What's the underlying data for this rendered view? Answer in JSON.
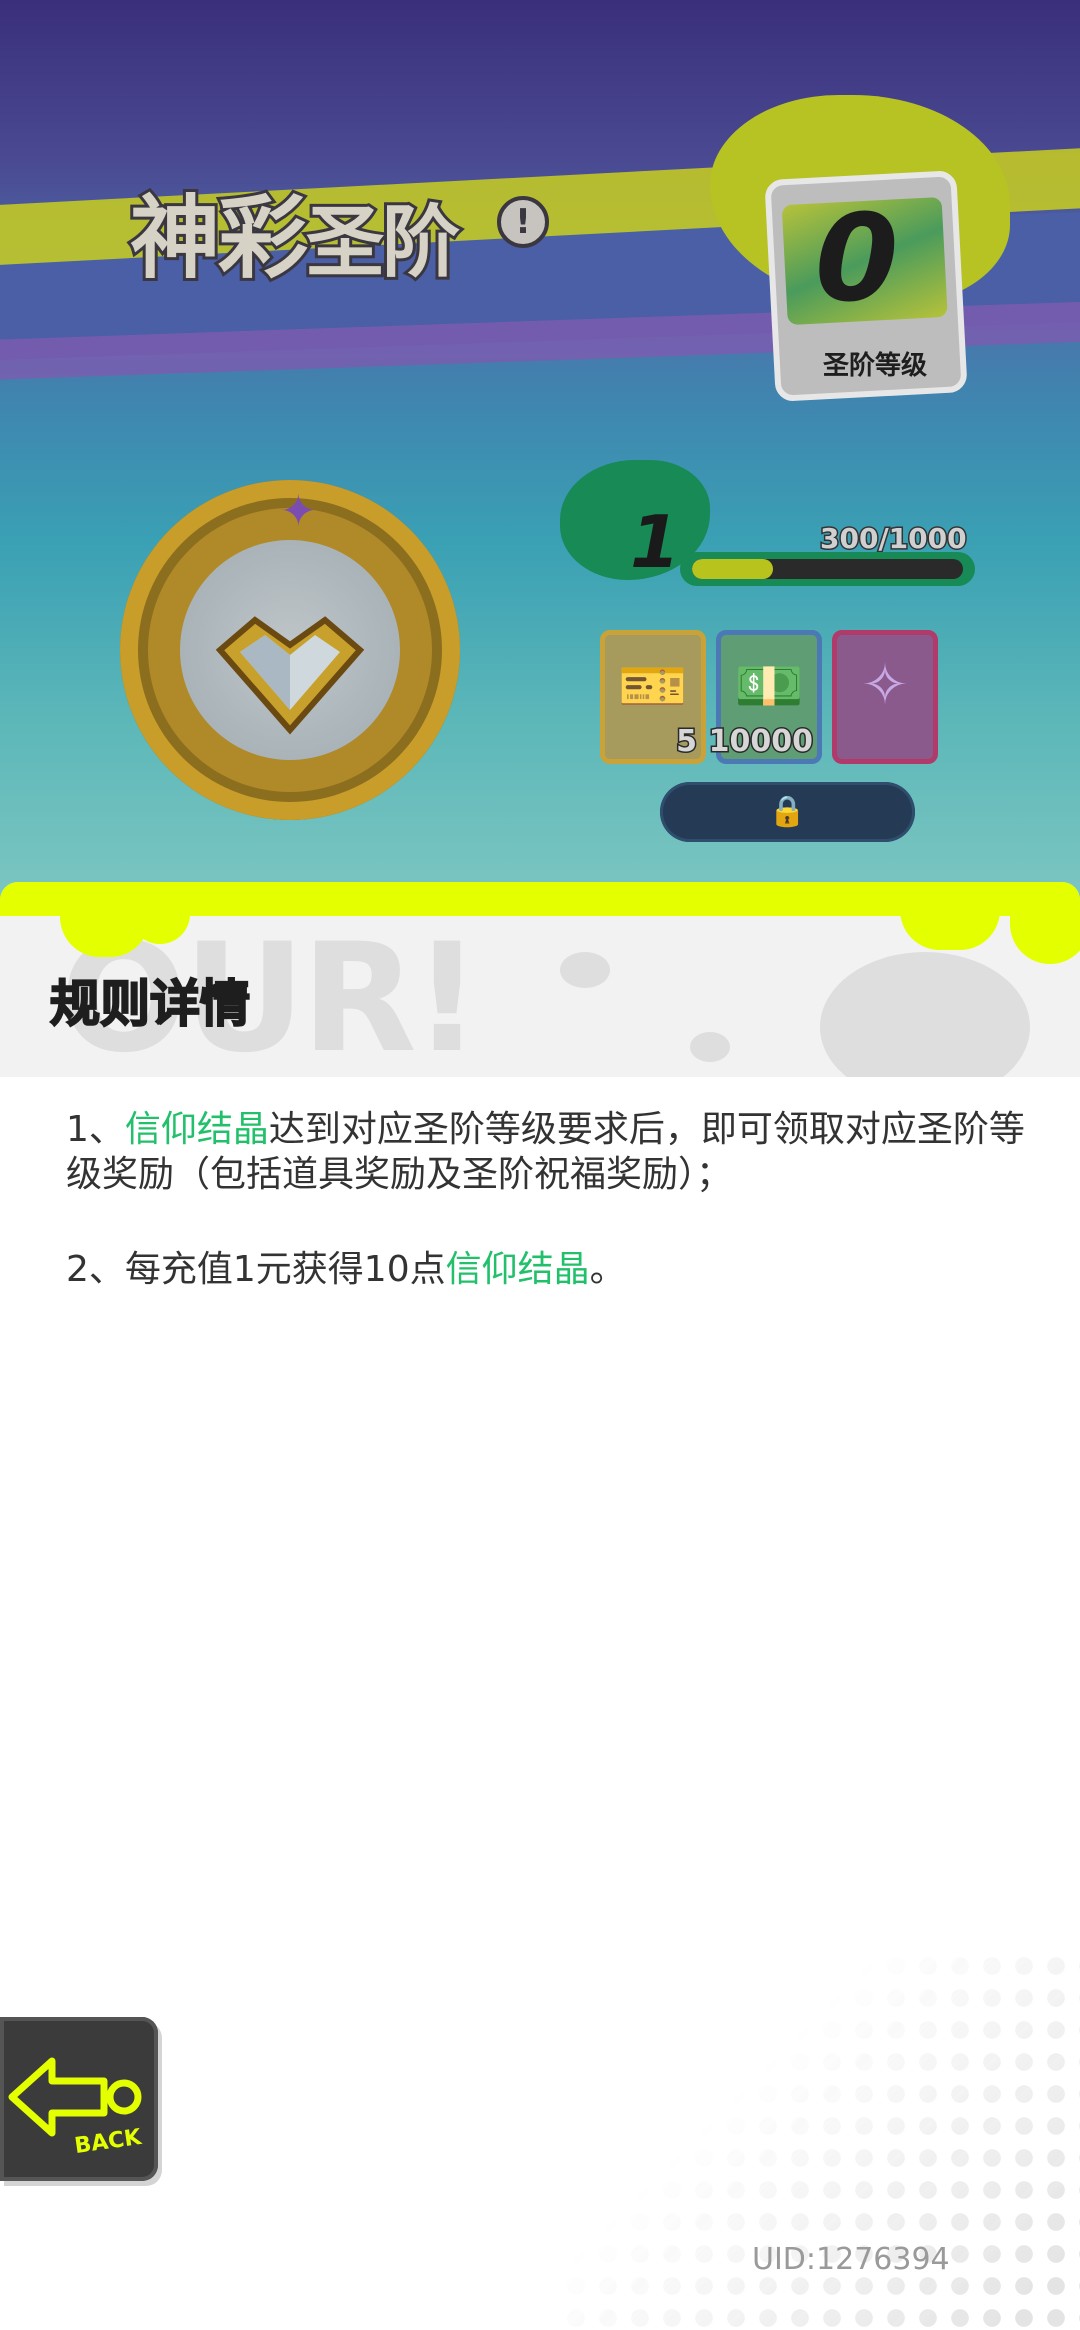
{
  "background": {
    "title": {
      "part1": "神彩",
      "part2": "圣阶"
    },
    "info_icon": "exclamation-icon",
    "rank": {
      "level": "0",
      "label": "圣阶等级"
    },
    "progress": {
      "level": "1",
      "text": "300/1000",
      "fraction": 0.3
    },
    "rewards": [
      {
        "icon": "ticket-icon",
        "count": "5"
      },
      {
        "icon": "cash-icon",
        "count": "10000"
      },
      {
        "icon": "badge-icon",
        "count": ""
      }
    ],
    "claim_icon": "lock-icon"
  },
  "panel": {
    "title": "规则详情",
    "rules": [
      {
        "prefix": "1、",
        "highlight": "信仰结晶",
        "text": "达到对应圣阶等级要求后，即可领取对应圣阶等级奖励（包括道具奖励及圣阶祝福奖励）；"
      },
      {
        "prefix": "2、每充值1元获得10点",
        "highlight": "信仰结晶",
        "text": "。"
      }
    ],
    "highlight_color": "#22c06a",
    "accent_color": "#e3ff00"
  },
  "back_button": {
    "label": "BACK"
  },
  "uid": "UID:1276394"
}
